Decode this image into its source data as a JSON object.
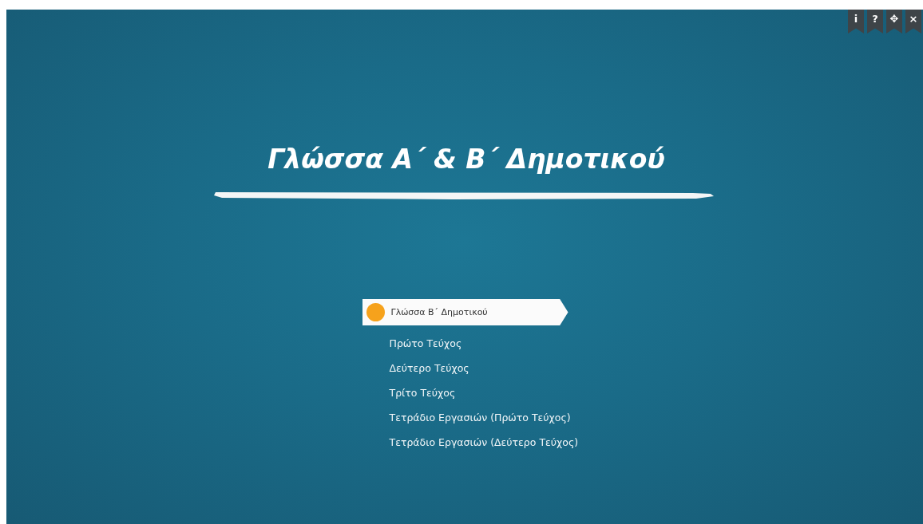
{
  "toolbar": [
    {
      "label": "i"
    },
    {
      "label": "?"
    },
    {
      "label": "✥"
    },
    {
      "label": "×"
    }
  ],
  "title": "Γλώσσα Α΄ & Β΄ Δημοτικού",
  "menu": {
    "title": "Γλώσσα Β΄ Δημοτικού",
    "selected": true,
    "items": [
      "Πρώτο Τεύχος",
      "Δεύτερο Τεύχος",
      "Τρίτο Τεύχος",
      "Τετράδιο Εργασιών (Πρώτο Τεύχος)",
      "Τετράδιο Εργασιών (Δεύτερο Τεύχος)"
    ]
  }
}
